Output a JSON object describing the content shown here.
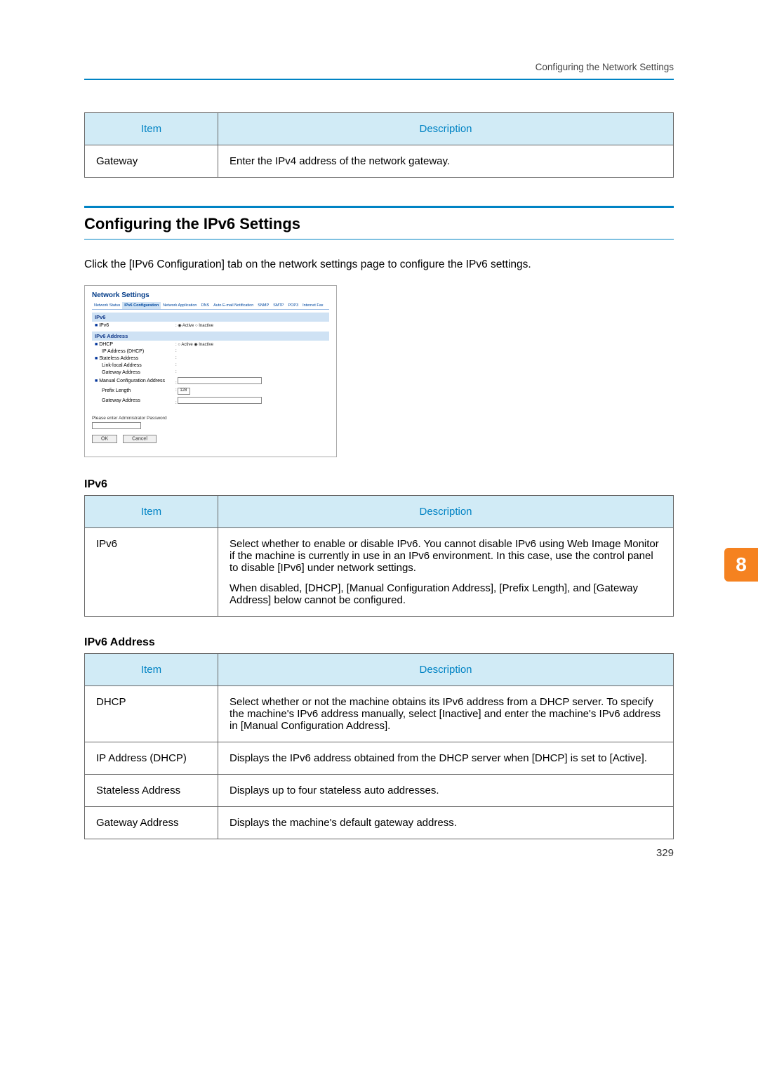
{
  "header": {
    "breadcrumb": "Configuring the Network Settings"
  },
  "table1": {
    "headers": {
      "item": "Item",
      "desc": "Description"
    },
    "rows": [
      {
        "item": "Gateway",
        "desc": "Enter the IPv4 address of the network gateway."
      }
    ]
  },
  "section_title": "Configuring the IPv6 Settings",
  "intro": "Click the [IPv6 Configuration] tab on the network settings page to configure the IPv6 settings.",
  "screenshot": {
    "title": "Network Settings",
    "tabs": [
      "Network Status",
      "IPv6 Configuration",
      "Network Application",
      "DNS",
      "Auto E-mail Notification",
      "SNMP",
      "SMTP",
      "POP3",
      "Internet Fax"
    ],
    "bar1": "IPv6",
    "ipv6_row": {
      "lab": "IPv6",
      "active": "Active",
      "inactive": "Inactive"
    },
    "bar2": "IPv6 Address",
    "rows": {
      "dhcp": "DHCP",
      "ip_dhcp": "IP Address (DHCP)",
      "stateless": "Stateless Address",
      "linklocal_lab": "Link-local Address",
      "linklocal_val": ":",
      "ga": "Gateway Address",
      "ga_val": ":",
      "mca": "Manual Configuration Address",
      "prefix": "Prefix Length",
      "prefix_val": "128",
      "gaddr": "Gateway Address"
    },
    "admin_note": "Please enter Administrator Password",
    "ok": "OK",
    "cancel": "Cancel"
  },
  "sub1": "IPv6",
  "table2": {
    "headers": {
      "item": "Item",
      "desc": "Description"
    },
    "rows": [
      {
        "item": "IPv6",
        "desc1": "Select whether to enable or disable IPv6. You cannot disable IPv6 using Web Image Monitor if the machine is currently in use in an IPv6 environment. In this case, use the control panel to disable [IPv6] under network settings.",
        "desc2": "When disabled, [DHCP], [Manual Configuration Address], [Prefix Length], and [Gateway Address] below cannot be configured."
      }
    ]
  },
  "sub2": "IPv6 Address",
  "table3": {
    "headers": {
      "item": "Item",
      "desc": "Description"
    },
    "rows": [
      {
        "item": "DHCP",
        "desc": "Select whether or not the machine obtains its IPv6 address from a DHCP server. To specify the machine's IPv6 address manually, select [Inactive] and enter the machine's IPv6 address in [Manual Configuration Address]."
      },
      {
        "item": "IP Address (DHCP)",
        "desc": "Displays the IPv6 address obtained from the DHCP server when [DHCP] is set to [Active]."
      },
      {
        "item": "Stateless Address",
        "desc": "Displays up to four stateless auto addresses."
      },
      {
        "item": "Gateway Address",
        "desc": "Displays the machine's default gateway address."
      }
    ]
  },
  "side_tab": "8",
  "page_number": "329"
}
